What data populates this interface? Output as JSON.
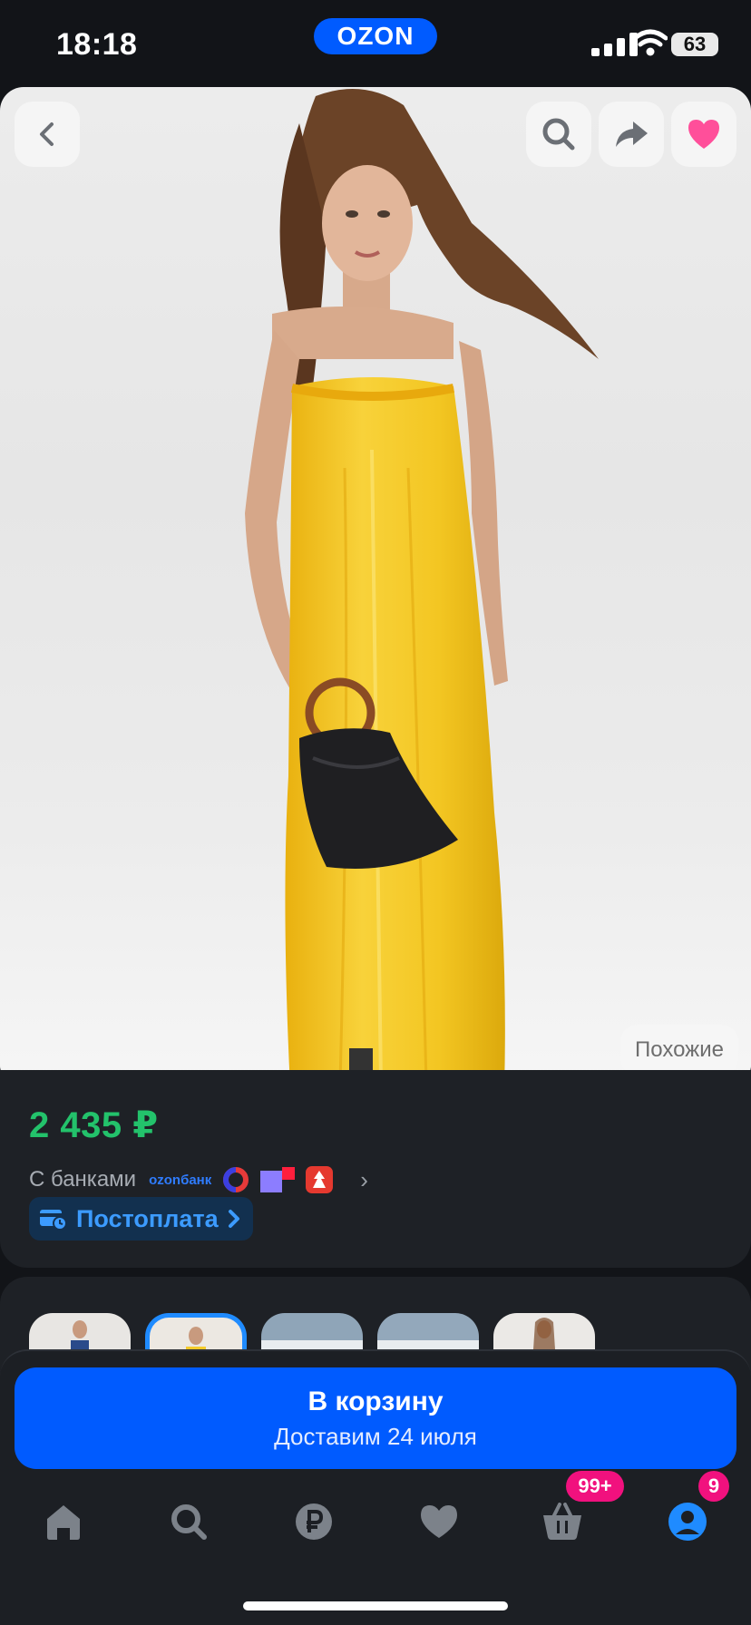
{
  "status_bar": {
    "time": "18:18",
    "brand": "OZON",
    "battery": "63",
    "icons": [
      "signal-icon",
      "wifi-icon",
      "battery-icon"
    ]
  },
  "hero": {
    "buttons": [
      "back-icon",
      "search-icon",
      "share-icon",
      "heart-icon"
    ],
    "similar_label": "Похожие",
    "favorite_color": "#ff4f9a"
  },
  "price_block": {
    "price": "2 435 ₽",
    "banks_label": "С банками",
    "bank_logos": [
      "ozon банк",
      "bank-ring-logo",
      "bank-flag-logo",
      "bank-red-logo"
    ],
    "ozonbank_line1": "ozon",
    "ozonbank_line2": "банк",
    "postpay_label": "Постоплата"
  },
  "thumbnails": {
    "count": 5,
    "selected_index": 1
  },
  "cart_button": {
    "title": "В корзину",
    "subtitle": "Доставим 24 июля"
  },
  "tab_bar": {
    "items": [
      "home-icon",
      "search-icon",
      "ruble-icon",
      "heart-icon",
      "basket-icon",
      "profile-icon"
    ],
    "basket_badge": "99+",
    "profile_badge": "9"
  },
  "colors": {
    "accent": "#005bff",
    "price_green": "#23c26b",
    "badge_pink": "#f1117e",
    "postpay_blue": "#3c9bff"
  }
}
